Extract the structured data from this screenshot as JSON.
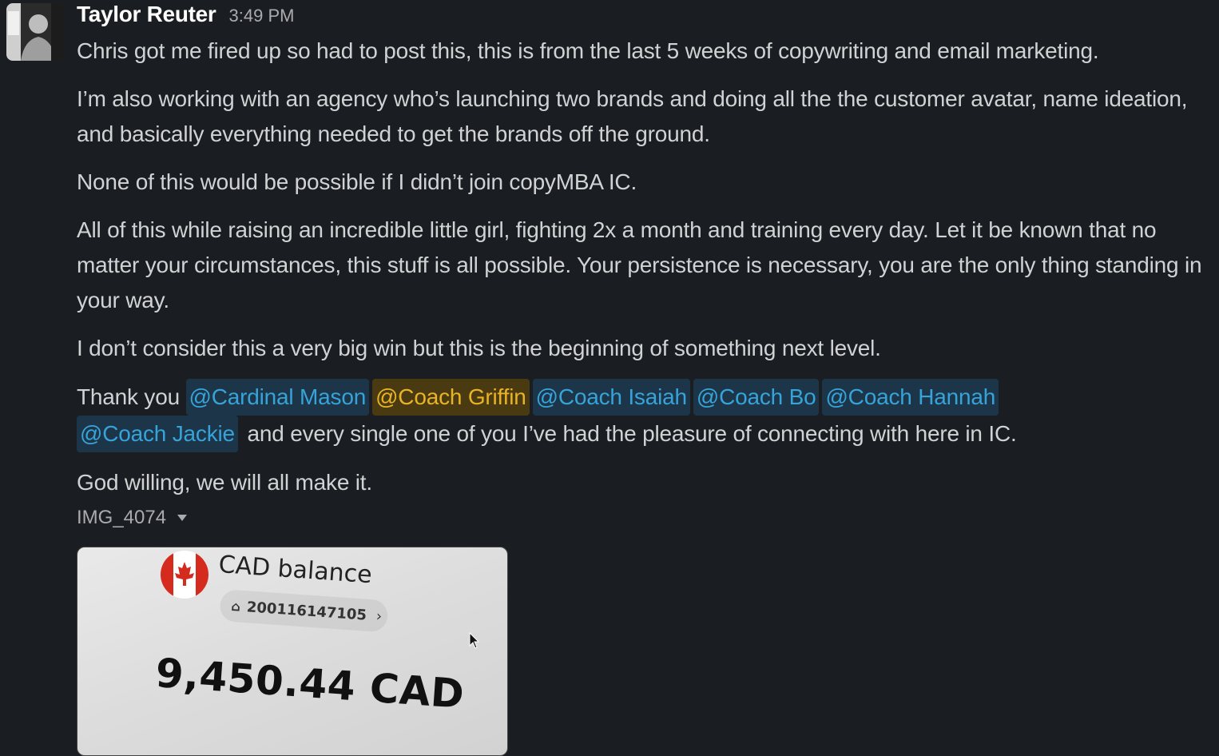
{
  "message": {
    "author": "Taylor Reuter",
    "timestamp": "3:49 PM",
    "paragraphs": [
      "Chris got me fired up so had to post this, this is from the last 5 weeks of copywriting and email marketing.",
      "I’m also working with an agency who’s launching two brands and doing all the the customer avatar, name ideation, and basically everything needed to get the brands off the ground.",
      "None of this would be possible if I didn’t join copyMBA IC.",
      "All of this while raising an incredible little girl, fighting 2x a month and training every day. Let it be known that no matter your circumstances, this stuff is all possible. Your persistence is necessary, you are the only thing standing in your way.",
      "I don’t consider this a very big win but this is the beginning of something next level."
    ],
    "thanks_prefix": "Thank you",
    "mentions": [
      "@Cardinal Mason",
      "@Coach Griffin",
      "@Coach Isaiah",
      "@Coach Bo",
      "@Coach Hannah",
      "@Coach Jackie"
    ],
    "thanks_suffix": "and every single one of you I’ve had the pleasure of connecting with here in IC.",
    "closing": "God willing, we will all make it.",
    "attachment": {
      "file_name": "IMG_4074",
      "image": {
        "title": "CAD balance",
        "account_number": "200116147105",
        "balance": "9,450.44 CAD"
      }
    }
  },
  "colors": {
    "background": "#1a1d21",
    "text": "#d1d2d3",
    "mention_text": "#36a3d9",
    "mention_bg": "#1d3549",
    "self_mention_text": "#e8b325",
    "self_mention_bg": "#4a3a12"
  },
  "icons": {
    "file_menu": "caret-down-icon",
    "bank": "bank-icon",
    "cursor": "mouse-pointer-icon"
  }
}
